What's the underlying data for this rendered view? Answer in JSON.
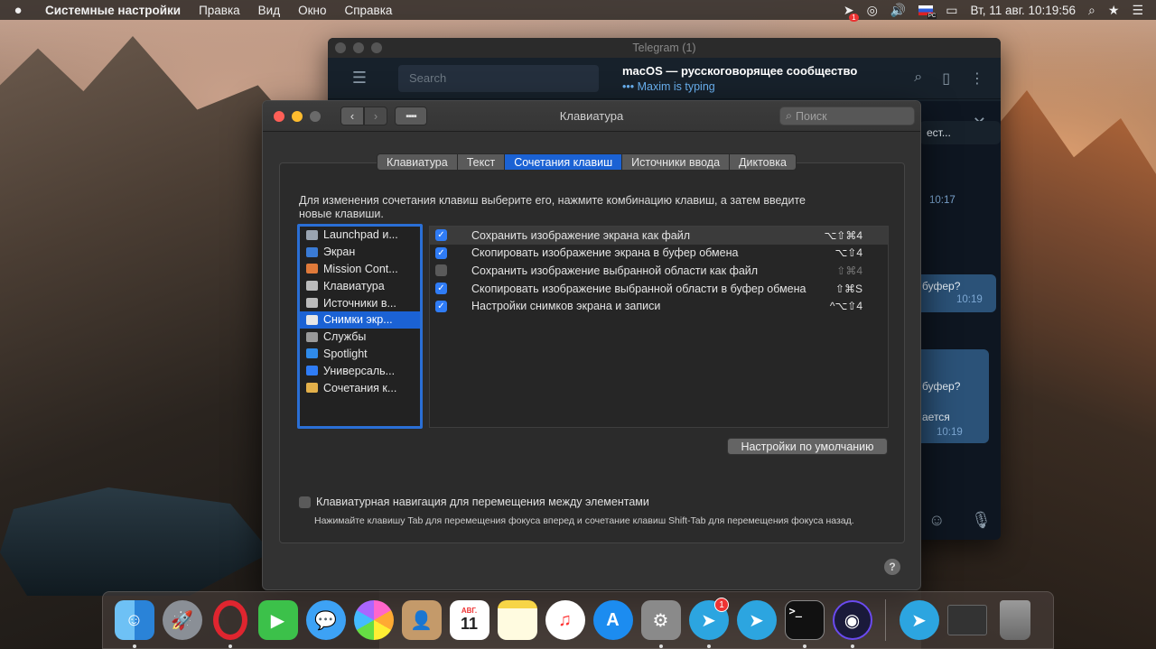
{
  "menubar": {
    "apple": "",
    "items": [
      "Системные настройки",
      "Правка",
      "Вид",
      "Окно",
      "Справка"
    ],
    "status": {
      "telegram_badge": "1",
      "datetime": "Вт, 11 авг.  10:19:56",
      "flag_label": "PC"
    }
  },
  "telegram": {
    "title": "Telegram (1)",
    "search_placeholder": "Search",
    "chat_name": "macOS — русскоговорящее сообщество",
    "typing": "••• Maxim is typing",
    "fragments": {
      "f1": "ест...",
      "t1": "10:17",
      "f2": "буфер?",
      "t2": "10:19",
      "f3": "буфер?",
      "f4": "ается",
      "t3": "10:19"
    }
  },
  "prefs": {
    "title": "Клавиатура",
    "search_placeholder": "Поиск",
    "tabs": [
      "Клавиатура",
      "Текст",
      "Сочетания клавиш",
      "Источники ввода",
      "Диктовка"
    ],
    "active_tab": 2,
    "description": "Для изменения сочетания клавиш выберите его, нажмите комбинацию клавиш, а затем введите новые клавиши.",
    "categories": [
      {
        "label": "Launchpad и...",
        "color": "#9aa4b0"
      },
      {
        "label": "Экран",
        "color": "#3a7bd5"
      },
      {
        "label": "Mission Cont...",
        "color": "#e07a3a"
      },
      {
        "label": "Клавиатура",
        "color": "#bbbbbb"
      },
      {
        "label": "Источники в...",
        "color": "#bbbbbb"
      },
      {
        "label": "Снимки экр...",
        "color": "#e6e6e6"
      },
      {
        "label": "Службы",
        "color": "#9a9a9a"
      },
      {
        "label": "Spotlight",
        "color": "#2f8ae8"
      },
      {
        "label": "Универсаль...",
        "color": "#2f7cf6"
      },
      {
        "label": "Сочетания к...",
        "color": "#e3b04a"
      }
    ],
    "selected_category": 5,
    "shortcuts": [
      {
        "checked": true,
        "label": "Сохранить изображение экрана как файл",
        "keys": "⌥⇧⌘4",
        "dim": false
      },
      {
        "checked": true,
        "label": "Скопировать изображение экрана в буфер обмена",
        "keys": "⌥⇧4",
        "dim": false
      },
      {
        "checked": false,
        "label": "Сохранить изображение выбранной области как файл",
        "keys": "⇧⌘4",
        "dim": true
      },
      {
        "checked": true,
        "label": "Скопировать изображение выбранной области в буфер обмена",
        "keys": "⇧⌘S",
        "dim": false
      },
      {
        "checked": true,
        "label": "Настройки снимков экрана и записи",
        "keys": "^⌥⇧4",
        "dim": false
      }
    ],
    "defaults_button": "Настройки по умолчанию",
    "kbnav_label": "Клавиатурная навигация для перемещения между элементами",
    "kbnav_hint": "Нажимайте клавишу Tab для перемещения фокуса вперед и сочетание клавиш Shift-Tab для перемещения фокуса назад.",
    "help": "?"
  },
  "dock": {
    "calendar_month": "АВГ.",
    "calendar_day": "11",
    "telegram_badge": "1"
  },
  "colors": {
    "accent": "#1b62d4",
    "checkbox": "#2f7cf6"
  }
}
